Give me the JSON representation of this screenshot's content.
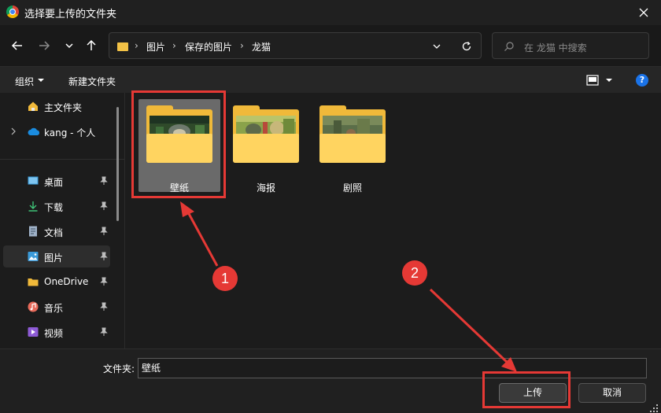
{
  "window": {
    "title": "选择要上传的文件夹"
  },
  "breadcrumb": [
    "图片",
    "保存的图片",
    "龙猫"
  ],
  "search": {
    "placeholder": "在 龙猫 中搜索"
  },
  "toolbar": {
    "organize_label": "组织",
    "new_folder_label": "新建文件夹"
  },
  "sidebar": {
    "items": [
      {
        "label": "主文件夹",
        "icon": "home-icon"
      },
      {
        "label": "kang - 个人",
        "icon": "onedrive-cloud-icon"
      },
      {
        "label": "桌面",
        "icon": "desktop-icon",
        "pinned": true
      },
      {
        "label": "下载",
        "icon": "download-icon",
        "pinned": true
      },
      {
        "label": "文档",
        "icon": "document-icon",
        "pinned": true
      },
      {
        "label": "图片",
        "icon": "pictures-icon",
        "pinned": true,
        "active": true
      },
      {
        "label": "OneDrive",
        "icon": "folder-icon",
        "pinned": true
      },
      {
        "label": "音乐",
        "icon": "music-icon",
        "pinned": true
      },
      {
        "label": "视频",
        "icon": "video-icon",
        "pinned": true
      }
    ]
  },
  "folders": [
    {
      "name": "壁纸",
      "selected": true
    },
    {
      "name": "海报",
      "selected": false
    },
    {
      "name": "剧照",
      "selected": false
    }
  ],
  "footer": {
    "folder_label": "文件夹:",
    "folder_value": "壁纸",
    "upload_label": "上传",
    "cancel_label": "取消"
  },
  "annotations": {
    "step1": "1",
    "step2": "2"
  },
  "colors": {
    "annotation": "#e53935",
    "folder": "#f0b93a",
    "accent": "#1a73e8"
  }
}
